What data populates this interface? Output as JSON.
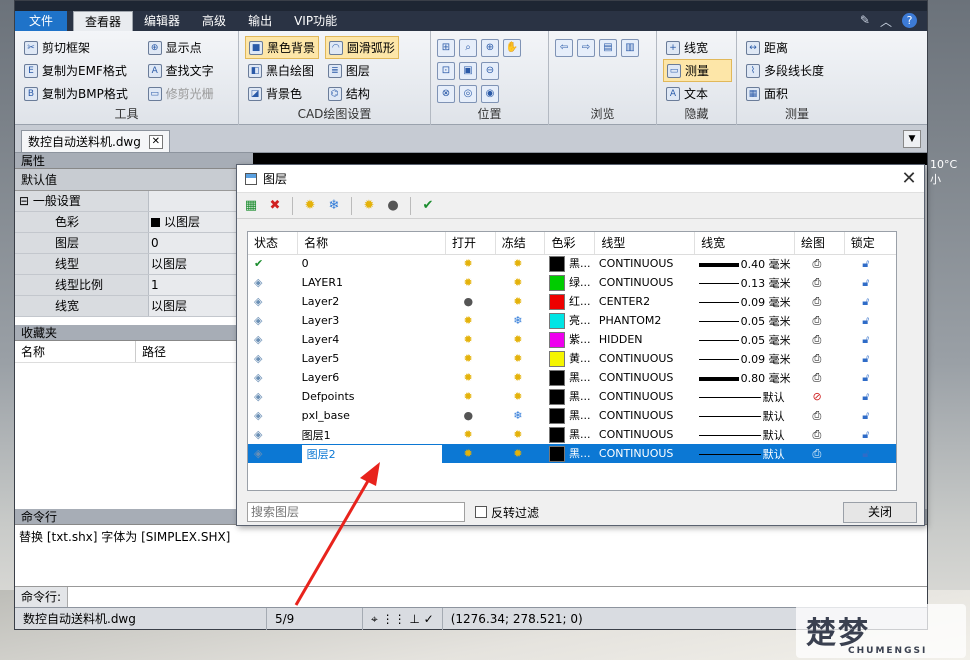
{
  "menu": {
    "items": [
      "文件",
      "查看器",
      "编辑器",
      "高级",
      "输出",
      "VIP功能"
    ],
    "active": "查看器"
  },
  "ribbon": {
    "tools": {
      "label": "工具",
      "buttons": [
        "剪切框架",
        "复制为EMF格式",
        "复制为BMP格式",
        "显示点",
        "查找文字",
        "修剪光栅"
      ]
    },
    "cad": {
      "label": "CAD绘图设置",
      "buttons": [
        "黑色背景",
        "黑白绘图",
        "背景色",
        "圆滑弧形",
        "图层",
        "结构"
      ]
    },
    "position": {
      "label": "位置"
    },
    "browse": {
      "label": "浏览"
    },
    "hide": {
      "label": "隐藏",
      "buttons": [
        "线宽",
        "测量",
        "文本"
      ]
    },
    "measure": {
      "label": "测量",
      "buttons": [
        "距离",
        "多段线长度",
        "面积"
      ]
    }
  },
  "doc": {
    "tab": "数控自动送料机.dwg"
  },
  "props": {
    "title": "属性",
    "default": "默认值",
    "category": "一般设置",
    "rows": [
      {
        "k": "色彩",
        "v": "以图层"
      },
      {
        "k": "图层",
        "v": "0"
      },
      {
        "k": "线型",
        "v": "以图层"
      },
      {
        "k": "线型比例",
        "v": "1"
      },
      {
        "k": "线宽",
        "v": "以图层"
      }
    ]
  },
  "fav": {
    "title": "收藏夹",
    "col1": "名称",
    "col2": "路径"
  },
  "cmd": {
    "title": "命令行",
    "text": "替换 [txt.shx] 字体为 [SIMPLEX.SHX]",
    "label": "命令行:"
  },
  "status": {
    "file": "数控自动送料机.dwg",
    "page": "5/9",
    "coords": "(1276.34; 278.521; 0)"
  },
  "dialog": {
    "title": "图层",
    "headers": [
      "状态",
      "名称",
      "打开",
      "冻结",
      "色彩",
      "线型",
      "线宽",
      "绘图",
      "锁定"
    ],
    "layers": [
      {
        "name": "0",
        "on": "sun",
        "frz": "sun",
        "color": "#000000",
        "cname": "黑...",
        "ltype": "CONTINUOUS",
        "lw": "0.40 毫米",
        "lwt": "thick"
      },
      {
        "name": "LAYER1",
        "on": "sun",
        "frz": "sun",
        "color": "#00cc00",
        "cname": "绿...",
        "ltype": "CONTINUOUS",
        "lw": "0.13 毫米",
        "lwt": "thin"
      },
      {
        "name": "Layer2",
        "on": "bulb",
        "frz": "sun",
        "color": "#ee0000",
        "cname": "红...",
        "ltype": "CENTER2",
        "lw": "0.09 毫米",
        "lwt": "thin"
      },
      {
        "name": "Layer3",
        "on": "sun",
        "frz": "snow",
        "color": "#00e5e5",
        "cname": "亮...",
        "ltype": "PHANTOM2",
        "lw": "0.05 毫米",
        "lwt": "thin"
      },
      {
        "name": "Layer4",
        "on": "sun",
        "frz": "sun",
        "color": "#ee00ee",
        "cname": "紫...",
        "ltype": "HIDDEN",
        "lw": "0.05 毫米",
        "lwt": "thin"
      },
      {
        "name": "Layer5",
        "on": "sun",
        "frz": "sun",
        "color": "#f5f500",
        "cname": "黄...",
        "ltype": "CONTINUOUS",
        "lw": "0.09 毫米",
        "lwt": "thin"
      },
      {
        "name": "Layer6",
        "on": "sun",
        "frz": "sun",
        "color": "#000000",
        "cname": "黑...",
        "ltype": "CONTINUOUS",
        "lw": "0.80 毫米",
        "lwt": "thick"
      },
      {
        "name": "Defpoints",
        "on": "sun",
        "frz": "sun",
        "color": "#000000",
        "cname": "黑...",
        "ltype": "CONTINUOUS",
        "lw": "默认",
        "lwt": "long"
      },
      {
        "name": "pxl_base",
        "on": "bulb",
        "frz": "snow",
        "color": "#000000",
        "cname": "黑...",
        "ltype": "CONTINUOUS",
        "lw": "默认",
        "lwt": "long"
      },
      {
        "name": "图层1",
        "on": "sun",
        "frz": "sun",
        "color": "#000000",
        "cname": "黑...",
        "ltype": "CONTINUOUS",
        "lw": "默认",
        "lwt": "long"
      },
      {
        "name": "图层2",
        "on": "sun",
        "frz": "sun",
        "color": "#000000",
        "cname": "黑...",
        "ltype": "CONTINUOUS",
        "lw": "默认",
        "lwt": "long",
        "selected": true
      }
    ],
    "search_placeholder": "搜索图层",
    "invert_label": "反转过滤",
    "close_label": "关闭"
  },
  "watermark": {
    "big": "楚梦",
    "small": "CHUMENGSI"
  },
  "weather": "10°C 小"
}
